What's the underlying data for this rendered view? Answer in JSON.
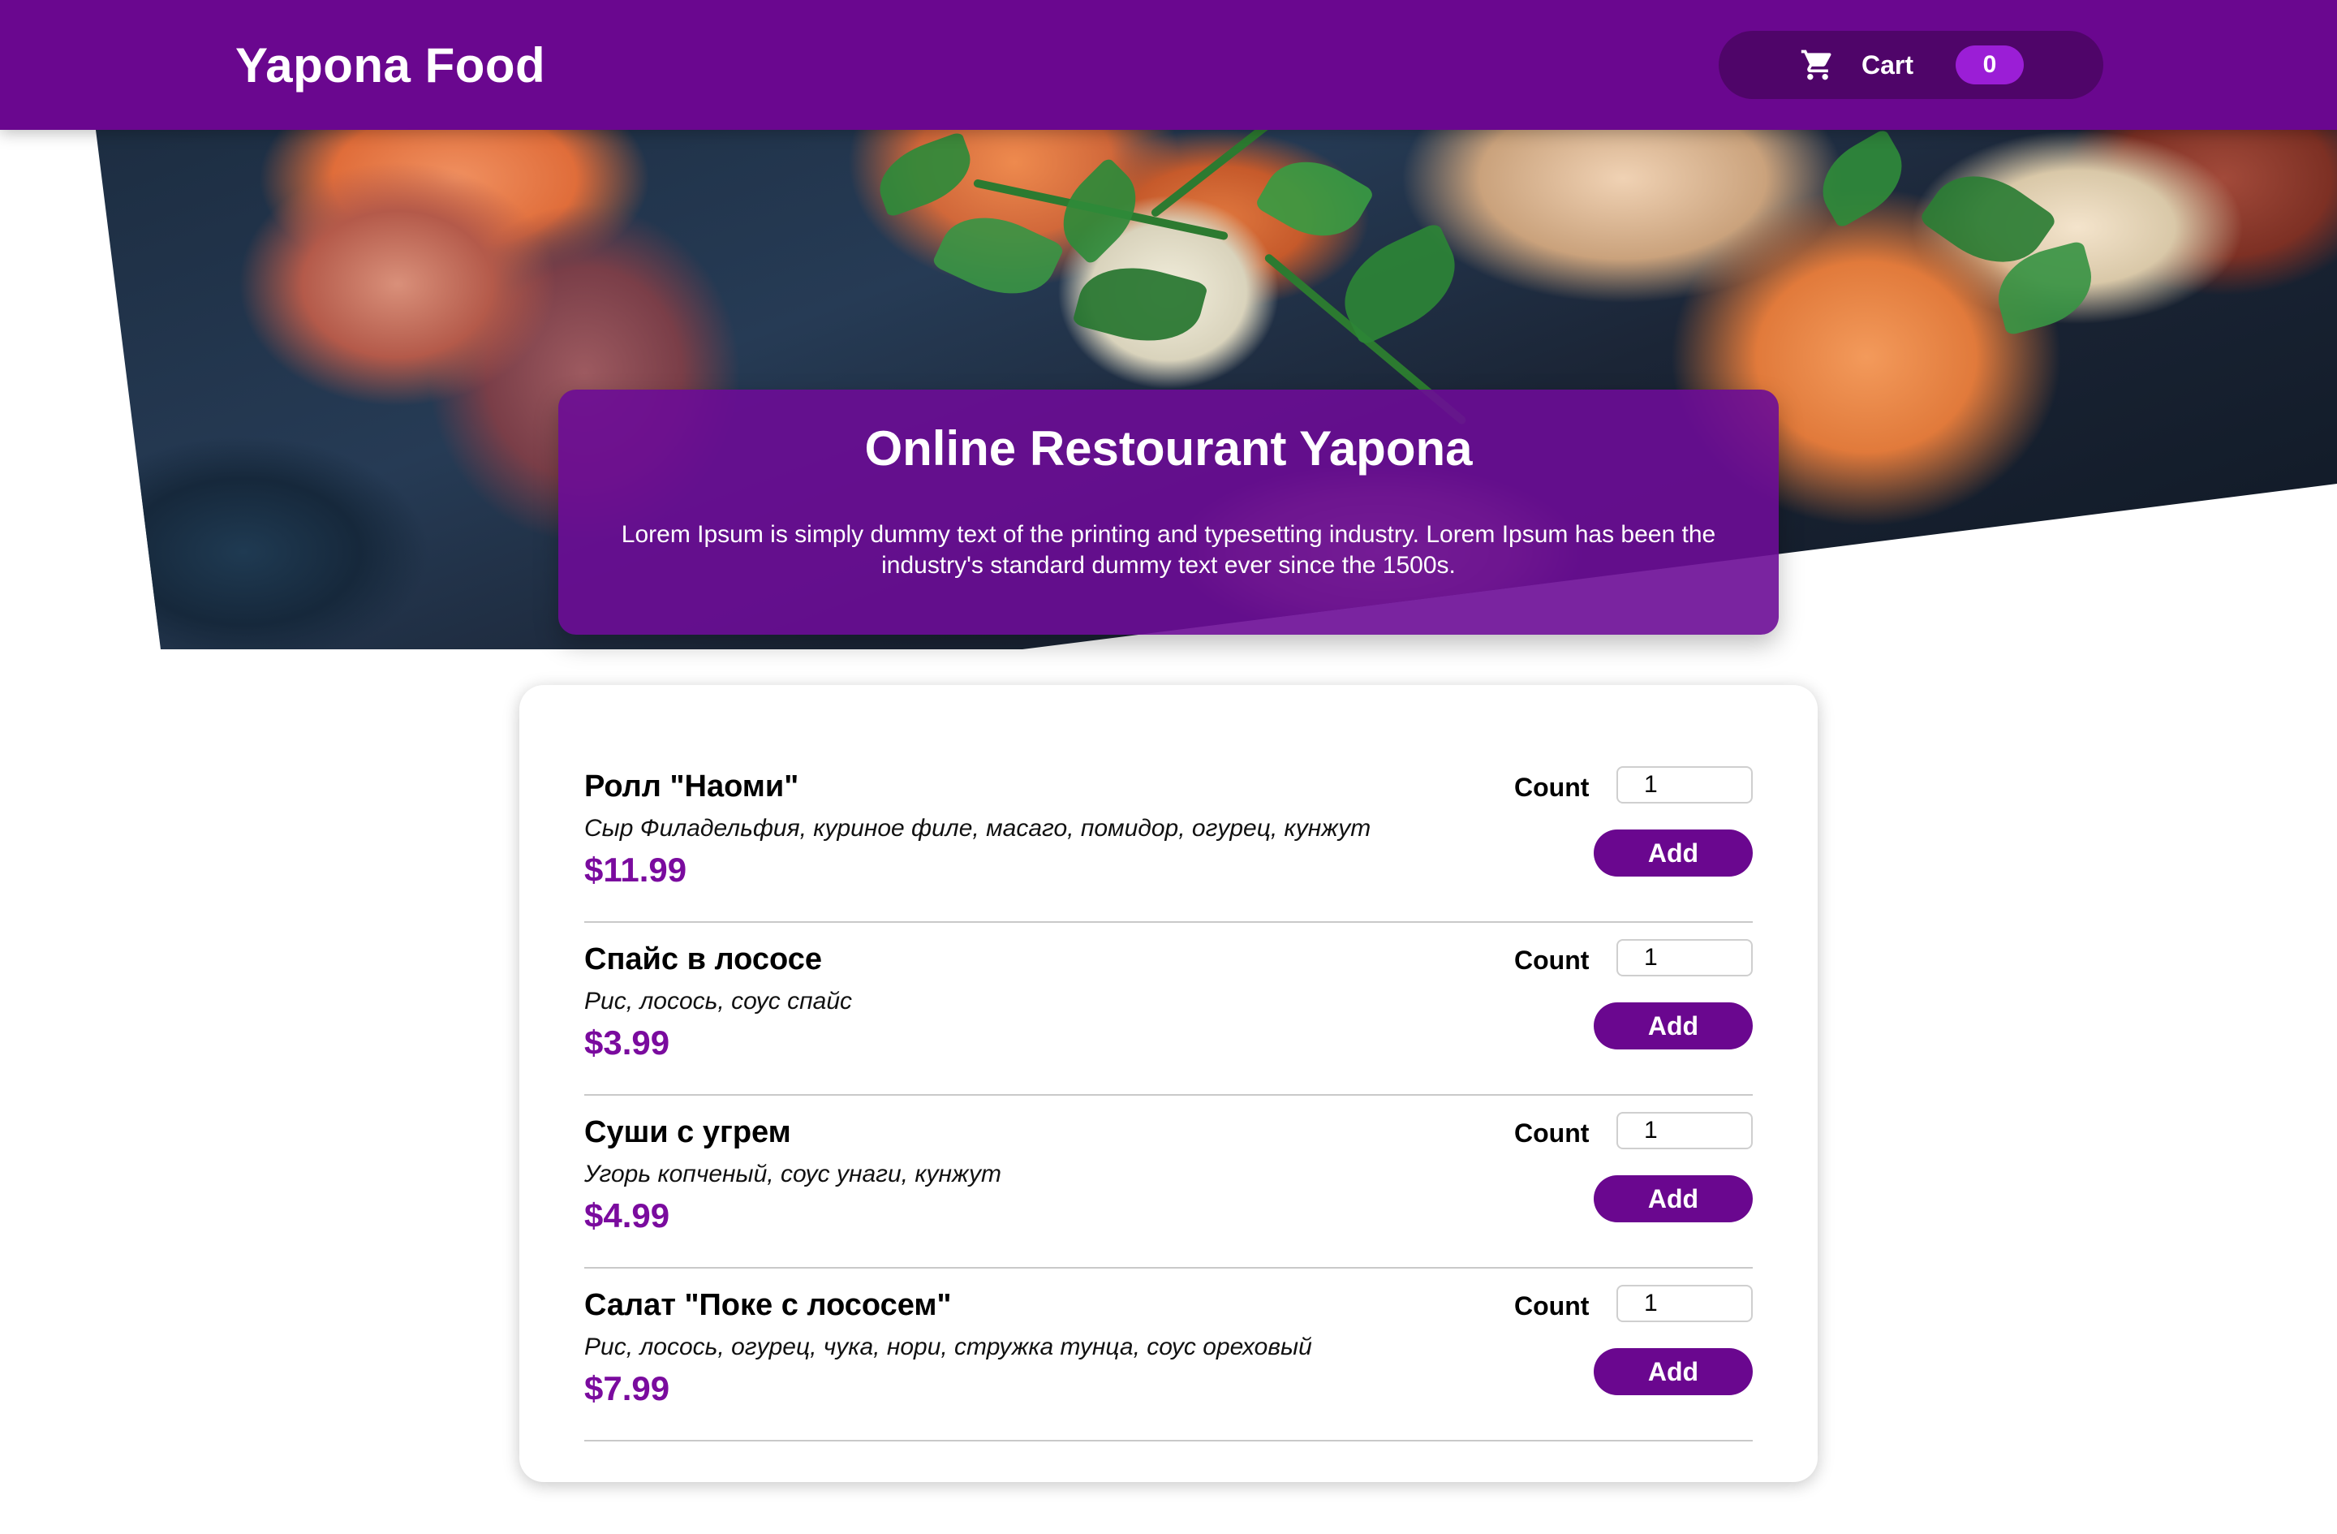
{
  "header": {
    "brand": "Yapona Food",
    "cart_label": "Cart",
    "cart_count": "0",
    "cart_icon": "shopping-cart-icon"
  },
  "hero": {
    "title": "Online Restourant Yapona",
    "description": "Lorem Ipsum is simply dummy text of the printing and typesetting industry. Lorem Ipsum has been the industry's standard dummy text ever since the 1500s."
  },
  "menu": {
    "items": [
      {
        "name": "Ролл \"Наоми\"",
        "description": "Сыр Филадельфия, куриное филе, масаго, помидор, огурец, кунжут",
        "price": "$11.99",
        "count_label": "Count",
        "count_value": "1",
        "add_label": "Add"
      },
      {
        "name": "Спайс в лососе",
        "description": "Рис, лосось, соус спайс",
        "price": "$3.99",
        "count_label": "Count",
        "count_value": "1",
        "add_label": "Add"
      },
      {
        "name": "Суши с угрем",
        "description": "Угорь копченый, соус унаги, кунжут",
        "price": "$4.99",
        "count_label": "Count",
        "count_value": "1",
        "add_label": "Add"
      },
      {
        "name": "Салат \"Поке с лососем\"",
        "description": "Рис, лосось, огурец, чука, нори, стружка тунца, соус ореховый",
        "price": "$7.99",
        "count_label": "Count",
        "count_value": "1",
        "add_label": "Add"
      }
    ]
  },
  "colors": {
    "brand_purple": "#6a078f",
    "cart_button": "#4f0569",
    "cart_badge": "#9b1ed6",
    "price": "#7a0b9e"
  }
}
